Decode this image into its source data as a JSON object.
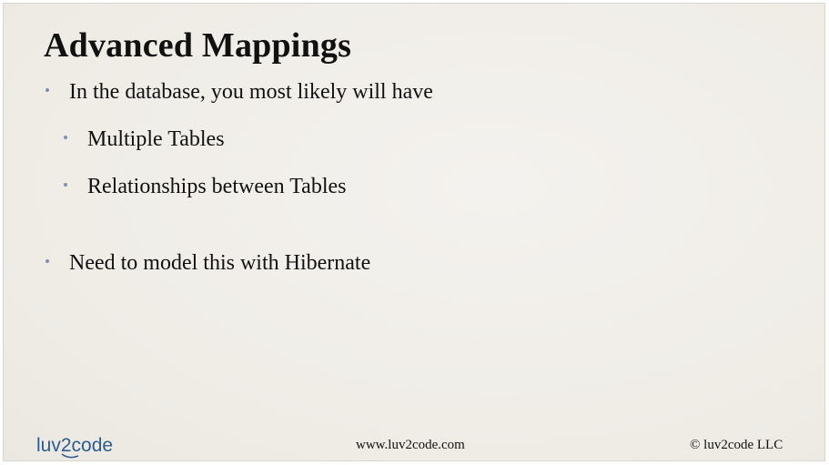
{
  "slide": {
    "title": "Advanced Mappings",
    "bullets": [
      "In the database, you most likely will have",
      "Multiple Tables",
      "Relationships between Tables",
      "Need to model this with Hibernate"
    ]
  },
  "footer": {
    "logo_text": "luv2code",
    "url": "www.luv2code.com",
    "copyright": "© luv2code LLC"
  },
  "colors": {
    "background": "#f1efea",
    "bullet_dot": "#7f8fb3",
    "logo_blue": "#2d5d8c"
  }
}
